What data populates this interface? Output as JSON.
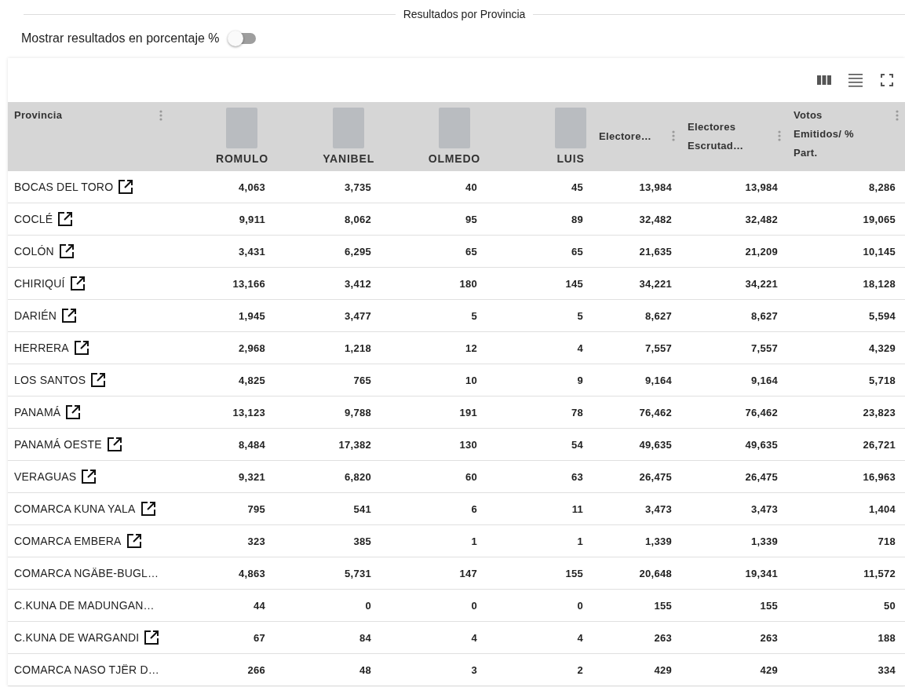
{
  "section_title": "Resultados por Provincia",
  "toggle": {
    "label": "Mostrar resultados en porcentaje %",
    "checked": false
  },
  "table": {
    "columns": [
      {
        "kind": "text",
        "label": "Provincia"
      },
      {
        "kind": "candidate",
        "label": "ROMULO"
      },
      {
        "kind": "candidate",
        "label": "YANIBEL"
      },
      {
        "kind": "candidate",
        "label": "OLMEDO"
      },
      {
        "kind": "candidate",
        "label": "LUIS"
      },
      {
        "kind": "text",
        "label": "Electore…"
      },
      {
        "kind": "text",
        "label": "Electores Escrutad…"
      },
      {
        "kind": "text",
        "label": "Votos Emitidos/ % Part."
      }
    ],
    "rows": [
      {
        "name": "BOCAS DEL TORO",
        "link": true,
        "values": [
          "4,063",
          "3,735",
          "40",
          "45",
          "13,984",
          "13,984",
          "8,286"
        ]
      },
      {
        "name": "COCLÉ",
        "link": true,
        "values": [
          "9,911",
          "8,062",
          "95",
          "89",
          "32,482",
          "32,482",
          "19,065"
        ]
      },
      {
        "name": "COLÓN",
        "link": true,
        "values": [
          "3,431",
          "6,295",
          "65",
          "65",
          "21,635",
          "21,209",
          "10,145"
        ]
      },
      {
        "name": "CHIRIQUÍ",
        "link": true,
        "values": [
          "13,166",
          "3,412",
          "180",
          "145",
          "34,221",
          "34,221",
          "18,128"
        ]
      },
      {
        "name": "DARIÉN",
        "link": true,
        "values": [
          "1,945",
          "3,477",
          "5",
          "5",
          "8,627",
          "8,627",
          "5,594"
        ]
      },
      {
        "name": "HERRERA",
        "link": true,
        "values": [
          "2,968",
          "1,218",
          "12",
          "4",
          "7,557",
          "7,557",
          "4,329"
        ]
      },
      {
        "name": "LOS SANTOS",
        "link": true,
        "values": [
          "4,825",
          "765",
          "10",
          "9",
          "9,164",
          "9,164",
          "5,718"
        ]
      },
      {
        "name": "PANAMÁ",
        "link": true,
        "values": [
          "13,123",
          "9,788",
          "191",
          "78",
          "76,462",
          "76,462",
          "23,823"
        ]
      },
      {
        "name": "PANAMÁ OESTE",
        "link": true,
        "values": [
          "8,484",
          "17,382",
          "130",
          "54",
          "49,635",
          "49,635",
          "26,721"
        ]
      },
      {
        "name": "VERAGUAS",
        "link": true,
        "values": [
          "9,321",
          "6,820",
          "60",
          "63",
          "26,475",
          "26,475",
          "16,963"
        ]
      },
      {
        "name": "COMARCA KUNA YALA",
        "link": true,
        "values": [
          "795",
          "541",
          "6",
          "11",
          "3,473",
          "3,473",
          "1,404"
        ]
      },
      {
        "name": "COMARCA EMBERA",
        "link": true,
        "values": [
          "323",
          "385",
          "1",
          "1",
          "1,339",
          "1,339",
          "718"
        ]
      },
      {
        "name": "COMARCA NGÄBE-BUGL…",
        "link": false,
        "values": [
          "4,863",
          "5,731",
          "147",
          "155",
          "20,648",
          "19,341",
          "11,572"
        ]
      },
      {
        "name": "C.KUNA DE MADUNGAN…",
        "link": false,
        "values": [
          "44",
          "0",
          "0",
          "0",
          "155",
          "155",
          "50"
        ]
      },
      {
        "name": "C.KUNA DE WARGANDI",
        "link": true,
        "values": [
          "67",
          "84",
          "4",
          "4",
          "263",
          "263",
          "188"
        ]
      },
      {
        "name": "COMARCA NASO TJËR D…",
        "link": false,
        "values": [
          "266",
          "48",
          "3",
          "2",
          "429",
          "429",
          "334"
        ]
      }
    ]
  }
}
